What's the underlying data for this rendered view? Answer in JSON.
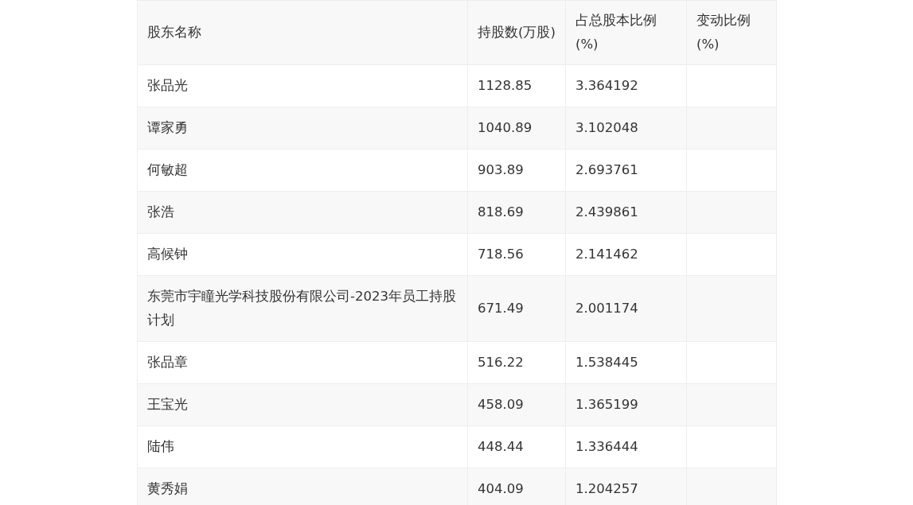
{
  "table": {
    "columns": [
      "股东名称",
      "持股数(万股)",
      "占总股本比例(%)",
      "变动比例(%)"
    ],
    "rows": [
      {
        "name": "张品光",
        "shares": "1128.85",
        "ratio": "3.364192"
      },
      {
        "name": "谭家勇",
        "shares": "1040.89",
        "ratio": "3.102048"
      },
      {
        "name": "何敏超",
        "shares": "903.89",
        "ratio": "2.693761"
      },
      {
        "name": "张浩",
        "shares": "818.69",
        "ratio": "2.439861"
      },
      {
        "name": "高候钟",
        "shares": "718.56",
        "ratio": "2.141462"
      },
      {
        "name": "东莞市宇瞳光学科技股份有限公司-2023年员工持股计划",
        "shares": "671.49",
        "ratio": "2.001174"
      },
      {
        "name": "张品章",
        "shares": "516.22",
        "ratio": "1.538445"
      },
      {
        "name": "王宝光",
        "shares": "458.09",
        "ratio": "1.365199"
      },
      {
        "name": "陆伟",
        "shares": "448.44",
        "ratio": "1.336444"
      },
      {
        "name": "黄秀娟",
        "shares": "404.09",
        "ratio": "1.204257"
      }
    ]
  }
}
